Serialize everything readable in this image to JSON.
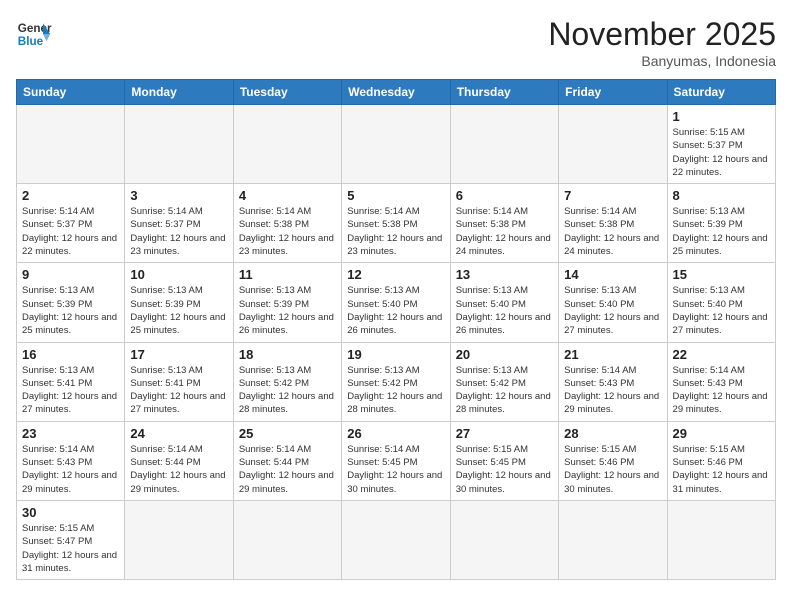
{
  "header": {
    "logo_general": "General",
    "logo_blue": "Blue",
    "month_title": "November 2025",
    "location": "Banyumas, Indonesia"
  },
  "weekdays": [
    "Sunday",
    "Monday",
    "Tuesday",
    "Wednesday",
    "Thursday",
    "Friday",
    "Saturday"
  ],
  "weeks": [
    [
      {
        "day": "",
        "info": ""
      },
      {
        "day": "",
        "info": ""
      },
      {
        "day": "",
        "info": ""
      },
      {
        "day": "",
        "info": ""
      },
      {
        "day": "",
        "info": ""
      },
      {
        "day": "",
        "info": ""
      },
      {
        "day": "1",
        "info": "Sunrise: 5:15 AM\nSunset: 5:37 PM\nDaylight: 12 hours and 22 minutes."
      }
    ],
    [
      {
        "day": "2",
        "info": "Sunrise: 5:14 AM\nSunset: 5:37 PM\nDaylight: 12 hours and 22 minutes."
      },
      {
        "day": "3",
        "info": "Sunrise: 5:14 AM\nSunset: 5:37 PM\nDaylight: 12 hours and 23 minutes."
      },
      {
        "day": "4",
        "info": "Sunrise: 5:14 AM\nSunset: 5:38 PM\nDaylight: 12 hours and 23 minutes."
      },
      {
        "day": "5",
        "info": "Sunrise: 5:14 AM\nSunset: 5:38 PM\nDaylight: 12 hours and 23 minutes."
      },
      {
        "day": "6",
        "info": "Sunrise: 5:14 AM\nSunset: 5:38 PM\nDaylight: 12 hours and 24 minutes."
      },
      {
        "day": "7",
        "info": "Sunrise: 5:14 AM\nSunset: 5:38 PM\nDaylight: 12 hours and 24 minutes."
      },
      {
        "day": "8",
        "info": "Sunrise: 5:13 AM\nSunset: 5:39 PM\nDaylight: 12 hours and 25 minutes."
      }
    ],
    [
      {
        "day": "9",
        "info": "Sunrise: 5:13 AM\nSunset: 5:39 PM\nDaylight: 12 hours and 25 minutes."
      },
      {
        "day": "10",
        "info": "Sunrise: 5:13 AM\nSunset: 5:39 PM\nDaylight: 12 hours and 25 minutes."
      },
      {
        "day": "11",
        "info": "Sunrise: 5:13 AM\nSunset: 5:39 PM\nDaylight: 12 hours and 26 minutes."
      },
      {
        "day": "12",
        "info": "Sunrise: 5:13 AM\nSunset: 5:40 PM\nDaylight: 12 hours and 26 minutes."
      },
      {
        "day": "13",
        "info": "Sunrise: 5:13 AM\nSunset: 5:40 PM\nDaylight: 12 hours and 26 minutes."
      },
      {
        "day": "14",
        "info": "Sunrise: 5:13 AM\nSunset: 5:40 PM\nDaylight: 12 hours and 27 minutes."
      },
      {
        "day": "15",
        "info": "Sunrise: 5:13 AM\nSunset: 5:40 PM\nDaylight: 12 hours and 27 minutes."
      }
    ],
    [
      {
        "day": "16",
        "info": "Sunrise: 5:13 AM\nSunset: 5:41 PM\nDaylight: 12 hours and 27 minutes."
      },
      {
        "day": "17",
        "info": "Sunrise: 5:13 AM\nSunset: 5:41 PM\nDaylight: 12 hours and 27 minutes."
      },
      {
        "day": "18",
        "info": "Sunrise: 5:13 AM\nSunset: 5:42 PM\nDaylight: 12 hours and 28 minutes."
      },
      {
        "day": "19",
        "info": "Sunrise: 5:13 AM\nSunset: 5:42 PM\nDaylight: 12 hours and 28 minutes."
      },
      {
        "day": "20",
        "info": "Sunrise: 5:13 AM\nSunset: 5:42 PM\nDaylight: 12 hours and 28 minutes."
      },
      {
        "day": "21",
        "info": "Sunrise: 5:14 AM\nSunset: 5:43 PM\nDaylight: 12 hours and 29 minutes."
      },
      {
        "day": "22",
        "info": "Sunrise: 5:14 AM\nSunset: 5:43 PM\nDaylight: 12 hours and 29 minutes."
      }
    ],
    [
      {
        "day": "23",
        "info": "Sunrise: 5:14 AM\nSunset: 5:43 PM\nDaylight: 12 hours and 29 minutes."
      },
      {
        "day": "24",
        "info": "Sunrise: 5:14 AM\nSunset: 5:44 PM\nDaylight: 12 hours and 29 minutes."
      },
      {
        "day": "25",
        "info": "Sunrise: 5:14 AM\nSunset: 5:44 PM\nDaylight: 12 hours and 29 minutes."
      },
      {
        "day": "26",
        "info": "Sunrise: 5:14 AM\nSunset: 5:45 PM\nDaylight: 12 hours and 30 minutes."
      },
      {
        "day": "27",
        "info": "Sunrise: 5:15 AM\nSunset: 5:45 PM\nDaylight: 12 hours and 30 minutes."
      },
      {
        "day": "28",
        "info": "Sunrise: 5:15 AM\nSunset: 5:46 PM\nDaylight: 12 hours and 30 minutes."
      },
      {
        "day": "29",
        "info": "Sunrise: 5:15 AM\nSunset: 5:46 PM\nDaylight: 12 hours and 31 minutes."
      }
    ],
    [
      {
        "day": "30",
        "info": "Sunrise: 5:15 AM\nSunset: 5:47 PM\nDaylight: 12 hours and 31 minutes."
      },
      {
        "day": "",
        "info": ""
      },
      {
        "day": "",
        "info": ""
      },
      {
        "day": "",
        "info": ""
      },
      {
        "day": "",
        "info": ""
      },
      {
        "day": "",
        "info": ""
      },
      {
        "day": "",
        "info": ""
      }
    ]
  ]
}
